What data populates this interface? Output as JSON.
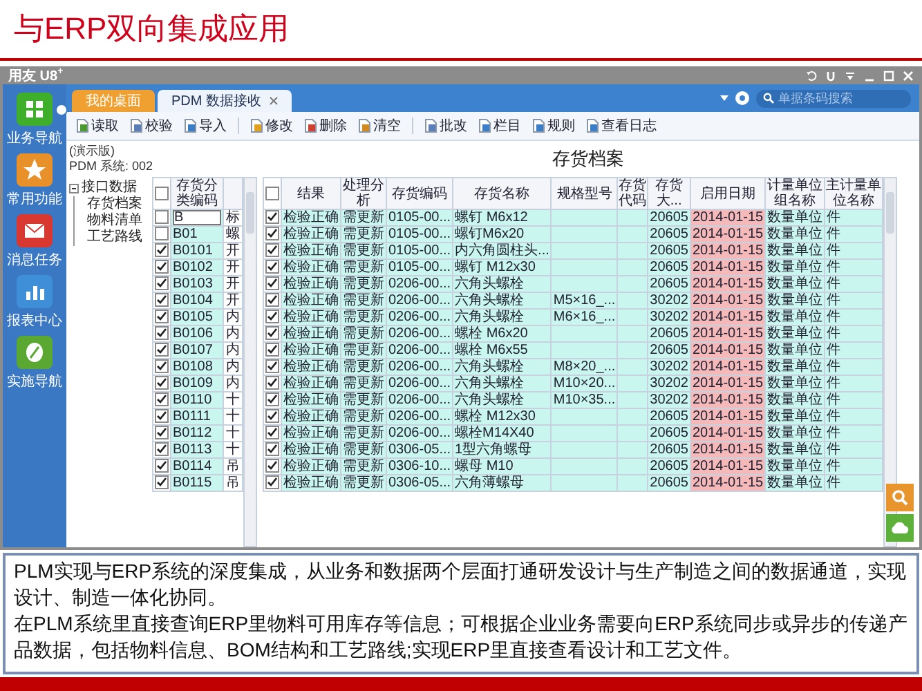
{
  "slide_title": "与ERP双向集成应用",
  "window": {
    "title": "用友 U8$^{+}$"
  },
  "sidebar": {
    "items": [
      {
        "label": "业务导航",
        "selected": true
      },
      {
        "label": "常用功能",
        "selected": false
      },
      {
        "label": "消息任务",
        "selected": false
      },
      {
        "label": "报表中心",
        "selected": false
      },
      {
        "label": "实施导航",
        "selected": false
      }
    ]
  },
  "tabs": [
    {
      "label": "我的桌面",
      "selected": false,
      "closable": false
    },
    {
      "label": "PDM 数据接收",
      "selected": true,
      "closable": true
    }
  ],
  "search": {
    "placeholder": "单据条码搜索"
  },
  "toolbar": [
    [
      {
        "label": "读取"
      },
      {
        "label": "校验"
      },
      {
        "label": "导入"
      }
    ],
    [
      {
        "label": "修改"
      },
      {
        "label": "删除"
      },
      {
        "label": "清空"
      }
    ],
    [
      {
        "label": "批改"
      },
      {
        "label": "栏目"
      },
      {
        "label": "规则"
      },
      {
        "label": "查看日志"
      }
    ]
  ],
  "edition": "(演示版)",
  "system": "PDM 系统: 002",
  "heading": "存货档案",
  "tree": [
    {
      "label": "接口数据",
      "expanded": true,
      "children": [
        {
          "label": "存货档案"
        },
        {
          "label": "物料清单"
        },
        {
          "label": "工艺路线"
        }
      ]
    }
  ],
  "category_grid": {
    "header_checked": false,
    "columns": [
      "存货分类编码"
    ],
    "rows": [
      {
        "checked": false,
        "code": "B",
        "column_3": "标",
        "editing": true
      },
      {
        "checked": false,
        "code": "B01",
        "column_3": "螺",
        "editing": false
      },
      {
        "checked": true,
        "code": "B0101",
        "column_3": "开",
        "editing": false
      },
      {
        "checked": true,
        "code": "B0102",
        "column_3": "开",
        "editing": false
      },
      {
        "checked": true,
        "code": "B0103",
        "column_3": "开",
        "editing": false
      },
      {
        "checked": true,
        "code": "B0104",
        "column_3": "开",
        "editing": false
      },
      {
        "checked": true,
        "code": "B0105",
        "column_3": "内",
        "editing": false
      },
      {
        "checked": true,
        "code": "B0106",
        "column_3": "内",
        "editing": false
      },
      {
        "checked": true,
        "code": "B0107",
        "column_3": "内",
        "editing": false
      },
      {
        "checked": true,
        "code": "B0108",
        "column_3": "内",
        "editing": false
      },
      {
        "checked": true,
        "code": "B0109",
        "column_3": "内",
        "editing": false
      },
      {
        "checked": true,
        "code": "B0110",
        "column_3": "十",
        "editing": false
      },
      {
        "checked": true,
        "code": "B0111",
        "column_3": "十",
        "editing": false
      },
      {
        "checked": true,
        "code": "B0112",
        "column_3": "十",
        "editing": false
      },
      {
        "checked": true,
        "code": "B0113",
        "column_3": "十",
        "editing": false
      },
      {
        "checked": true,
        "code": "B0114",
        "column_3": "吊",
        "editing": false
      },
      {
        "checked": true,
        "code": "B0115",
        "column_3": "吊",
        "editing": false
      }
    ]
  },
  "inventory_grid": {
    "header_checked": false,
    "columns": [
      "结果",
      "处理分析",
      "存货编码",
      "存货名称",
      "规格型号",
      "存货代码",
      "存货大...",
      "启用日期",
      "计量单位组名称",
      "主计量单位名称"
    ],
    "rows": [
      {
        "checked": true,
        "result": "检验正确",
        "analysis": "需更新",
        "code": "0105-00...",
        "name": "螺钉 M6x12",
        "category": "20605",
        "date": "2014-01-15",
        "unit_group": "数量单位",
        "unit": "件"
      },
      {
        "checked": true,
        "result": "检验正确",
        "analysis": "需更新",
        "code": "0105-00...",
        "name": "螺钉M6x20",
        "category": "20605",
        "date": "2014-01-15",
        "unit_group": "数量单位",
        "unit": "件"
      },
      {
        "checked": true,
        "result": "检验正确",
        "analysis": "需更新",
        "code": "0105-00...",
        "name": "内六角圆柱头...",
        "category": "20605",
        "date": "2014-01-15",
        "unit_group": "数量单位",
        "unit": "件"
      },
      {
        "checked": true,
        "result": "检验正确",
        "analysis": "需更新",
        "code": "0105-00...",
        "name": "螺钉 M12x30",
        "category": "20605",
        "date": "2014-01-15",
        "unit_group": "数量单位",
        "unit": "件"
      },
      {
        "checked": true,
        "result": "检验正确",
        "analysis": "需更新",
        "code": "0206-00...",
        "name": "六角头螺栓",
        "category": "20605",
        "date": "2014-01-15",
        "unit_group": "数量单位",
        "unit": "件"
      },
      {
        "checked": true,
        "result": "检验正确",
        "analysis": "需更新",
        "code": "0206-00...",
        "name": "六角头螺栓",
        "spec": "M5×16_...",
        "category": "30202",
        "date": "2014-01-15",
        "unit_group": "数量单位",
        "unit": "件"
      },
      {
        "checked": true,
        "result": "检验正确",
        "analysis": "需更新",
        "code": "0206-00...",
        "name": "六角头螺栓",
        "spec": "M6×16_...",
        "category": "30202",
        "date": "2014-01-15",
        "unit_group": "数量单位",
        "unit": "件"
      },
      {
        "checked": true,
        "result": "检验正确",
        "analysis": "需更新",
        "code": "0206-00...",
        "name": "螺栓 M6x20",
        "category": "20605",
        "date": "2014-01-15",
        "unit_group": "数量单位",
        "unit": "件"
      },
      {
        "checked": true,
        "result": "检验正确",
        "analysis": "需更新",
        "code": "0206-00...",
        "name": "螺栓 M6x55",
        "category": "20605",
        "date": "2014-01-15",
        "unit_group": "数量单位",
        "unit": "件"
      },
      {
        "checked": true,
        "result": "检验正确",
        "analysis": "需更新",
        "code": "0206-00...",
        "name": "六角头螺栓",
        "spec": "M8×20_...",
        "category": "30202",
        "date": "2014-01-15",
        "unit_group": "数量单位",
        "unit": "件"
      },
      {
        "checked": true,
        "result": "检验正确",
        "analysis": "需更新",
        "code": "0206-00...",
        "name": "六角头螺栓",
        "spec": "M10×20...",
        "category": "30202",
        "date": "2014-01-15",
        "unit_group": "数量单位",
        "unit": "件"
      },
      {
        "checked": true,
        "result": "检验正确",
        "analysis": "需更新",
        "code": "0206-00...",
        "name": "六角头螺栓",
        "spec": "M10×35...",
        "category": "30202",
        "date": "2014-01-15",
        "unit_group": "数量单位",
        "unit": "件"
      },
      {
        "checked": true,
        "result": "检验正确",
        "analysis": "需更新",
        "code": "0206-00...",
        "name": "螺栓 M12x30",
        "category": "20605",
        "date": "2014-01-15",
        "unit_group": "数量单位",
        "unit": "件"
      },
      {
        "checked": true,
        "result": "检验正确",
        "analysis": "需更新",
        "code": "0206-00...",
        "name": "螺栓M14X40",
        "category": "20605",
        "date": "2014-01-15",
        "unit_group": "数量单位",
        "unit": "件"
      },
      {
        "checked": true,
        "result": "检验正确",
        "analysis": "需更新",
        "code": "0306-05...",
        "name": "1型六角螺母",
        "category": "20605",
        "date": "2014-01-15",
        "unit_group": "数量单位",
        "unit": "件"
      },
      {
        "checked": true,
        "result": "检验正确",
        "analysis": "需更新",
        "code": "0306-10...",
        "name": "螺母 M10",
        "category": "20605",
        "date": "2014-01-15",
        "unit_group": "数量单位",
        "unit": "件"
      },
      {
        "checked": true,
        "result": "检验正确",
        "analysis": "需更新",
        "code": "0306-05...",
        "name": "六角薄螺母",
        "category": "20605",
        "date": "2014-01-15",
        "unit_group": "数量单位",
        "unit": "件"
      }
    ]
  },
  "note": [
    "PLM实现与ERP系统的深度集成，从业务和数据两个层面打通研发设计与生产制造之间的数据通道，实现设计、制造一体化协同。",
    "在PLM系统里直接查询ERP里物料可用库存等信息；可根据企业业务需要向ERP系统同步或异步的传递产品数据，包括物料信息、BOM结构和工艺路线;实现ERP里直接查看设计和工艺文件。"
  ]
}
